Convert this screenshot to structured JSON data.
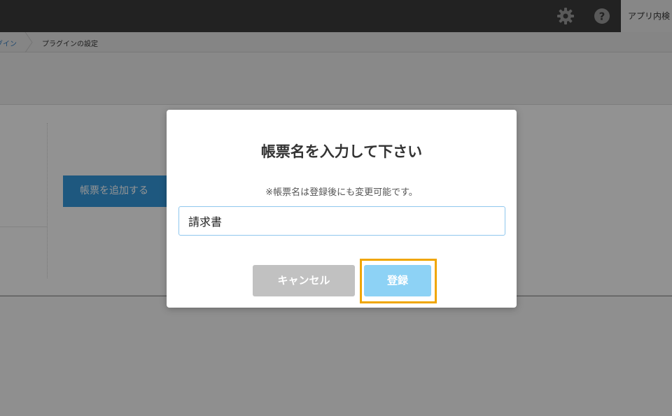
{
  "topbar": {
    "settings_icon": "gear-icon",
    "help_icon": "question-circle-icon",
    "search_label": "アプリ内検"
  },
  "breadcrumb": {
    "parent": "グイン",
    "current": "プラグインの設定"
  },
  "page": {
    "add_button_label": "帳票を追加する"
  },
  "dialog": {
    "title": "帳票名を入力して下さい",
    "note": "※帳票名は登録後にも変更可能です。",
    "input_value": "請求書",
    "cancel_label": "キャンセル",
    "submit_label": "登録"
  },
  "colors": {
    "topbar": "#3b3b3b",
    "link": "#3a7fbf",
    "primary_button": "#3498db",
    "submit_button": "#8dd2f5",
    "cancel_button": "#c1c1c1",
    "highlight_border": "#f0a600",
    "input_border": "#8fc7ee"
  }
}
